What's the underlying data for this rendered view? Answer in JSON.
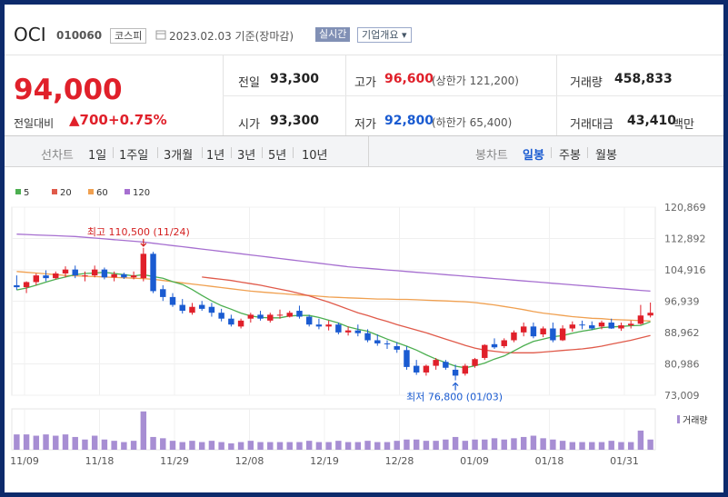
{
  "header": {
    "name": "OCI",
    "code": "010060",
    "market": "코스피",
    "date": "2023.02.03",
    "basis": "기준(장마감)",
    "realtime_label": "실시간",
    "company_label": "기업개요 ▾"
  },
  "quote": {
    "price": "94,000",
    "change_label": "전일대비",
    "change": "▲700",
    "change_pct": "+0.75%",
    "prev_close_label": "전일",
    "prev_close": "93,300",
    "open_label": "시가",
    "open": "93,300",
    "high_label": "고가",
    "high": "96,600",
    "upper_limit": "(상한가 121,200)",
    "low_label": "저가",
    "low": "92,800",
    "lower_limit": "(하한가 65,400)",
    "volume_label": "거래량",
    "volume": "458,833",
    "amount_label": "거래대금",
    "amount": "43,410",
    "amount_unit": "백만"
  },
  "tabs": {
    "line_label": "선차트",
    "line": [
      "1일",
      "1주일",
      "3개월",
      "1년",
      "3년",
      "5년",
      "10년"
    ],
    "candle_label": "봉차트",
    "candle": [
      "일봉",
      "주봉",
      "월봉"
    ],
    "active_candle": "일봉"
  },
  "colors": {
    "up": "#e0202a",
    "down": "#1a5bd1",
    "ma5": "#4caf50",
    "ma20": "#e05a4a",
    "ma60": "#f0a050",
    "ma120": "#a66fd0",
    "volume": "#a78ed3"
  },
  "chart_data": {
    "type": "candlestick",
    "ylim": [
      73009,
      120869
    ],
    "y_ticks": [
      "120,869",
      "112,892",
      "104,916",
      "96,939",
      "88,962",
      "80,986",
      "73,009"
    ],
    "x_ticks": [
      "11/09",
      "11/18",
      "11/29",
      "12/08",
      "12/19",
      "12/28",
      "01/09",
      "01/18",
      "01/31"
    ],
    "legend": [
      "5",
      "20",
      "60",
      "120"
    ],
    "volume_label": "거래량",
    "annotations": {
      "high": "최고 110,500 (11/24)",
      "low": "최저 76,800 (01/03)"
    },
    "candles": [
      [
        101000,
        103500,
        99800,
        100500
      ],
      [
        100500,
        102000,
        99000,
        101800
      ],
      [
        101800,
        104000,
        101000,
        103500
      ],
      [
        103500,
        104800,
        102000,
        102800
      ],
      [
        102800,
        104500,
        102500,
        104000
      ],
      [
        104000,
        105800,
        103000,
        105000
      ],
      [
        105000,
        106000,
        102800,
        103500
      ],
      [
        103500,
        104500,
        102000,
        103500
      ],
      [
        103500,
        106000,
        103000,
        105000
      ],
      [
        105000,
        105500,
        102500,
        103000
      ],
      [
        103000,
        104500,
        102000,
        103800
      ],
      [
        103800,
        104200,
        102600,
        103000
      ],
      [
        103000,
        104500,
        102500,
        103500
      ],
      [
        102800,
        110500,
        102000,
        109000
      ],
      [
        109000,
        109500,
        99000,
        99500
      ],
      [
        100000,
        101000,
        97000,
        98000
      ],
      [
        98000,
        99000,
        95500,
        96000
      ],
      [
        96000,
        97500,
        93800,
        94500
      ],
      [
        94000,
        96500,
        93500,
        95500
      ],
      [
        96000,
        97000,
        94500,
        95000
      ],
      [
        95500,
        96500,
        93000,
        94000
      ],
      [
        94000,
        95000,
        91800,
        92500
      ],
      [
        92500,
        93500,
        90500,
        91000
      ],
      [
        90500,
        92500,
        90000,
        92000
      ],
      [
        92500,
        94000,
        91500,
        93500
      ],
      [
        93500,
        94500,
        92000,
        92500
      ],
      [
        92000,
        94000,
        91500,
        93500
      ],
      [
        93500,
        94800,
        92500,
        93500
      ],
      [
        93000,
        94500,
        92800,
        94000
      ],
      [
        94500,
        95800,
        92500,
        93000
      ],
      [
        93000,
        93500,
        90500,
        91000
      ],
      [
        91000,
        92500,
        89800,
        90500
      ],
      [
        90500,
        92000,
        89500,
        91000
      ],
      [
        91000,
        91500,
        88500,
        89000
      ],
      [
        89000,
        90500,
        88200,
        89500
      ],
      [
        89500,
        91000,
        88000,
        88800
      ],
      [
        88800,
        89800,
        86500,
        87000
      ],
      [
        87000,
        88500,
        85600,
        86200
      ],
      [
        86200,
        87000,
        84800,
        86000
      ],
      [
        85500,
        86500,
        83800,
        84600
      ],
      [
        84500,
        85500,
        79500,
        80200
      ],
      [
        80500,
        82000,
        78200,
        78800
      ],
      [
        78800,
        80800,
        78000,
        80500
      ],
      [
        80500,
        82500,
        79500,
        82000
      ],
      [
        81500,
        82000,
        79500,
        80000
      ],
      [
        79500,
        80800,
        76800,
        78000
      ],
      [
        78500,
        81000,
        78000,
        80500
      ],
      [
        80500,
        82500,
        80000,
        82200
      ],
      [
        82500,
        86000,
        82000,
        85800
      ],
      [
        86000,
        87500,
        84800,
        85200
      ],
      [
        85500,
        87500,
        85000,
        87000
      ],
      [
        87000,
        89500,
        86500,
        89000
      ],
      [
        89000,
        91500,
        88000,
        90500
      ],
      [
        90500,
        91500,
        87500,
        88000
      ],
      [
        88500,
        90500,
        87800,
        90000
      ],
      [
        90000,
        91500,
        86500,
        87000
      ],
      [
        87000,
        90800,
        86800,
        90000
      ],
      [
        90000,
        91800,
        89200,
        91000
      ],
      [
        91000,
        92000,
        89800,
        90800
      ],
      [
        90800,
        91800,
        89600,
        90000
      ],
      [
        90500,
        92000,
        89800,
        91500
      ],
      [
        91500,
        92500,
        89900,
        90000
      ],
      [
        90000,
        91500,
        89400,
        90800
      ],
      [
        90800,
        92000,
        90000,
        91200
      ],
      [
        91200,
        96000,
        91000,
        93300
      ],
      [
        93300,
        96600,
        92800,
        94000
      ]
    ],
    "volume": [
      60,
      60,
      55,
      60,
      55,
      60,
      50,
      40,
      55,
      40,
      35,
      30,
      35,
      150,
      50,
      45,
      35,
      30,
      35,
      30,
      35,
      30,
      25,
      30,
      35,
      30,
      30,
      30,
      30,
      30,
      35,
      30,
      30,
      35,
      30,
      30,
      35,
      30,
      30,
      35,
      40,
      40,
      35,
      35,
      40,
      50,
      35,
      40,
      40,
      45,
      40,
      45,
      50,
      55,
      45,
      40,
      35,
      30,
      30,
      30,
      30,
      35,
      30,
      30,
      75,
      40
    ],
    "ma5": [
      99800,
      100300,
      101000,
      101800,
      102500,
      103100,
      103700,
      104000,
      104100,
      104300,
      104000,
      103700,
      103400,
      103700,
      103200,
      102800,
      101900,
      101200,
      99900,
      98400,
      97000,
      95800,
      94900,
      93900,
      93200,
      92800,
      92700,
      92700,
      93200,
      93300,
      93300,
      92800,
      92100,
      91400,
      90400,
      89800,
      89300,
      88300,
      87300,
      86400,
      85500,
      84500,
      83300,
      82200,
      81300,
      80400,
      80000,
      80500,
      81200,
      82200,
      83000,
      84300,
      85600,
      86700,
      87300,
      87900,
      88200,
      88800,
      89300,
      89700,
      90200,
      90400,
      90500,
      90700,
      90800,
      91700
    ],
    "ma20": [
      null,
      null,
      null,
      null,
      null,
      null,
      null,
      null,
      null,
      null,
      null,
      null,
      null,
      null,
      null,
      null,
      null,
      null,
      null,
      103100,
      102800,
      102500,
      102200,
      101800,
      101400,
      101000,
      100500,
      100000,
      99500,
      98900,
      98300,
      97500,
      96700,
      95800,
      94900,
      94000,
      93300,
      92500,
      91800,
      91000,
      90300,
      89600,
      88900,
      88100,
      87300,
      86500,
      85700,
      85000,
      84500,
      84200,
      83900,
      83800,
      83800,
      83800,
      84000,
      84200,
      84400,
      84600,
      84800,
      85100,
      85500,
      86000,
      86500,
      87000,
      87600,
      88200
    ],
    "ma60": [
      104500,
      104300,
      104100,
      103900,
      103700,
      103500,
      103400,
      103300,
      103200,
      103100,
      103000,
      102900,
      102800,
      102700,
      102500,
      102200,
      101900,
      101600,
      101300,
      101000,
      100700,
      100400,
      100100,
      99800,
      99500,
      99300,
      99100,
      98900,
      98700,
      98500,
      98400,
      98200,
      98000,
      97900,
      97800,
      97700,
      97600,
      97500,
      97500,
      97400,
      97400,
      97300,
      97200,
      97100,
      97000,
      96900,
      96800,
      96600,
      96300,
      96000,
      95600,
      95200,
      94800,
      94300,
      93900,
      93600,
      93300,
      93000,
      92800,
      92600,
      92500,
      92300,
      92200,
      92100,
      92000,
      91900
    ],
    "ma120": [
      114000,
      113900,
      113800,
      113700,
      113600,
      113500,
      113400,
      113200,
      113000,
      112800,
      112600,
      112400,
      112200,
      112000,
      111700,
      111400,
      111100,
      110800,
      110500,
      110200,
      109900,
      109600,
      109300,
      109000,
      108700,
      108400,
      108100,
      107800,
      107500,
      107200,
      106900,
      106600,
      106300,
      106000,
      105700,
      105500,
      105300,
      105100,
      104900,
      104700,
      104500,
      104300,
      104100,
      103900,
      103700,
      103500,
      103300,
      103100,
      102900,
      102700,
      102500,
      102300,
      102100,
      101900,
      101700,
      101500,
      101300,
      101100,
      100900,
      100700,
      100500,
      100300,
      100100,
      99900,
      99700,
      99500
    ]
  }
}
